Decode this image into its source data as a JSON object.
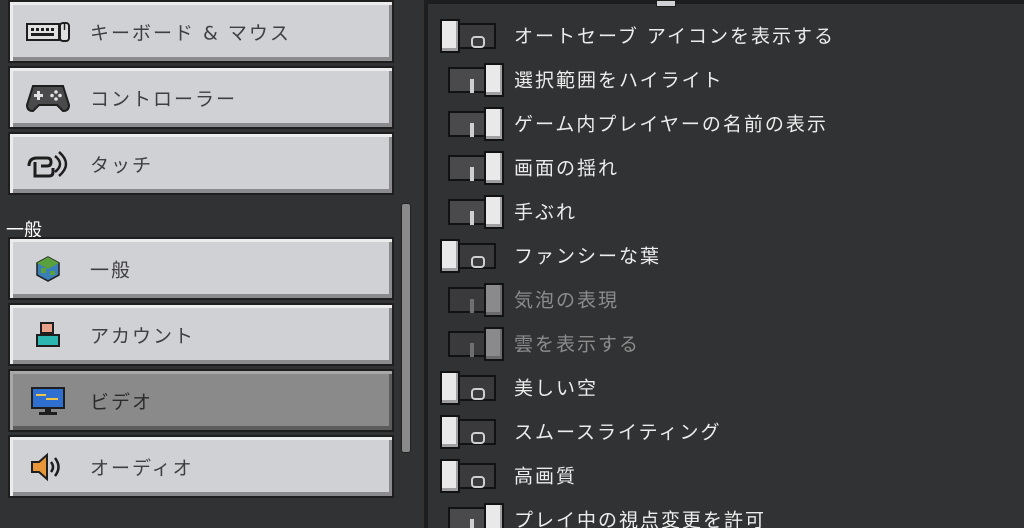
{
  "sidebar": {
    "section_general": "一般",
    "items": [
      {
        "id": "keyboard-mouse",
        "label": "キーボード & マウス",
        "icon": "keyboard-mouse-icon",
        "selected": false
      },
      {
        "id": "controller",
        "label": "コントローラー",
        "icon": "gamepad-icon",
        "selected": false
      },
      {
        "id": "touch",
        "label": "タッチ",
        "icon": "touch-hand-icon",
        "selected": false
      },
      {
        "id": "general",
        "label": "一般",
        "icon": "globe-icon",
        "selected": false
      },
      {
        "id": "account",
        "label": "アカウント",
        "icon": "account-icon",
        "selected": false
      },
      {
        "id": "video",
        "label": "ビデオ",
        "icon": "monitor-icon",
        "selected": true
      },
      {
        "id": "audio",
        "label": "オーディオ",
        "icon": "speaker-icon",
        "selected": false
      }
    ]
  },
  "settings": [
    {
      "label": "オートセーブ アイコンを表示する",
      "state": "off",
      "enabled": true
    },
    {
      "label": "選択範囲をハイライト",
      "state": "on",
      "enabled": true
    },
    {
      "label": "ゲーム内プレイヤーの名前の表示",
      "state": "on",
      "enabled": true
    },
    {
      "label": "画面の揺れ",
      "state": "on",
      "enabled": true
    },
    {
      "label": "手ぶれ",
      "state": "on",
      "enabled": true
    },
    {
      "label": "ファンシーな葉",
      "state": "off",
      "enabled": true
    },
    {
      "label": "気泡の表現",
      "state": "on",
      "enabled": false
    },
    {
      "label": "雲を表示する",
      "state": "on",
      "enabled": false
    },
    {
      "label": "美しい空",
      "state": "off",
      "enabled": true
    },
    {
      "label": "スムースライティング",
      "state": "off",
      "enabled": true
    },
    {
      "label": "高画質",
      "state": "off",
      "enabled": true
    },
    {
      "label": "プレイ中の視点変更を許可",
      "state": "on",
      "enabled": true
    }
  ],
  "colors": {
    "background": "#313233",
    "button_face": "#d0d1d4",
    "button_selected": "#8a8a8a",
    "text_light": "#ececec",
    "text_dark": "#3f3f41",
    "text_disabled": "#8c8c8c"
  }
}
